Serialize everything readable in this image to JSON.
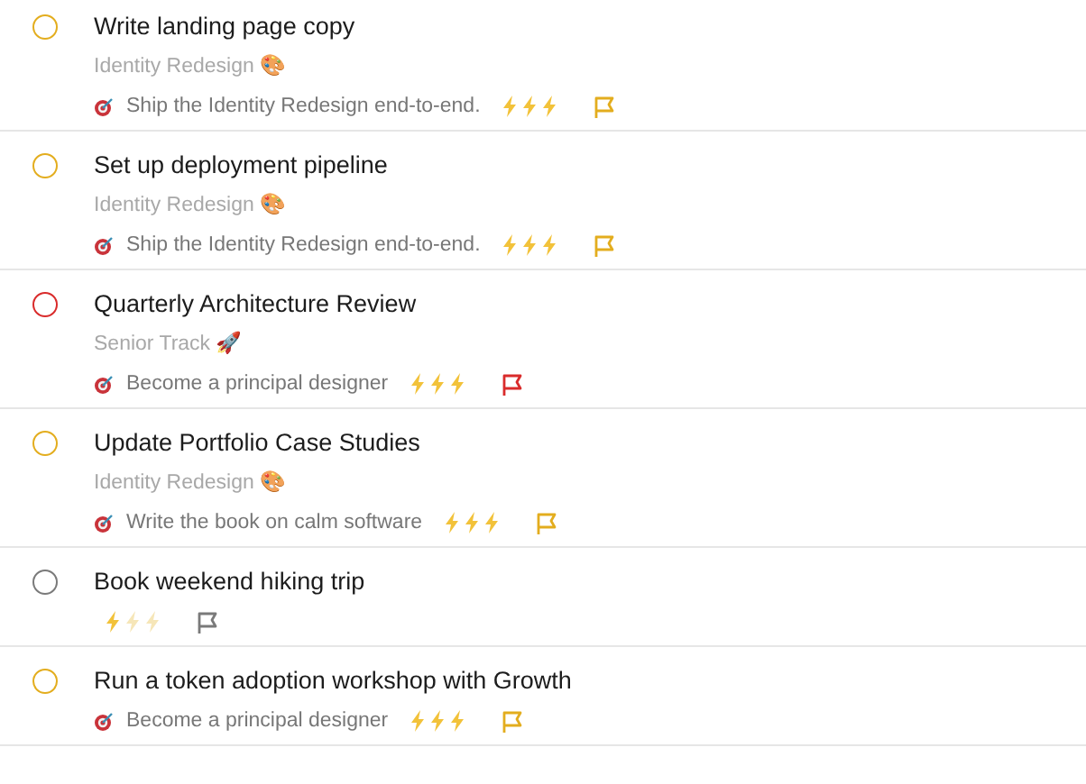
{
  "tasks": [
    {
      "title": "Write landing page copy",
      "color": "#e3ad1e",
      "project": "Identity Redesign 🎨",
      "goal": "Ship the Identity Redesign end-to-end.",
      "stars": 3
    },
    {
      "title": "Set up deployment pipeline",
      "color": "#e3ad1e",
      "project": "Identity Redesign 🎨",
      "goal": "Ship the Identity Redesign end-to-end.",
      "stars": 3
    },
    {
      "title": "Quarterly Architecture Review",
      "color": "#d92b2b",
      "project": "Senior Track 🚀",
      "goal": "Become a principal designer",
      "stars": 3
    },
    {
      "title": "Update Portfolio Case Studies",
      "color": "#e3ad1e",
      "project": "Identity Redesign 🎨",
      "goal": "Write the book on calm software",
      "stars": 3
    },
    {
      "title": "Book weekend hiking trip",
      "color": "#7a7a7a",
      "stars": 1
    },
    {
      "title": "Run a token adoption workshop with Growth",
      "color": "#e3ad1e",
      "goal": "Become a principal designer",
      "stars": 3
    }
  ]
}
